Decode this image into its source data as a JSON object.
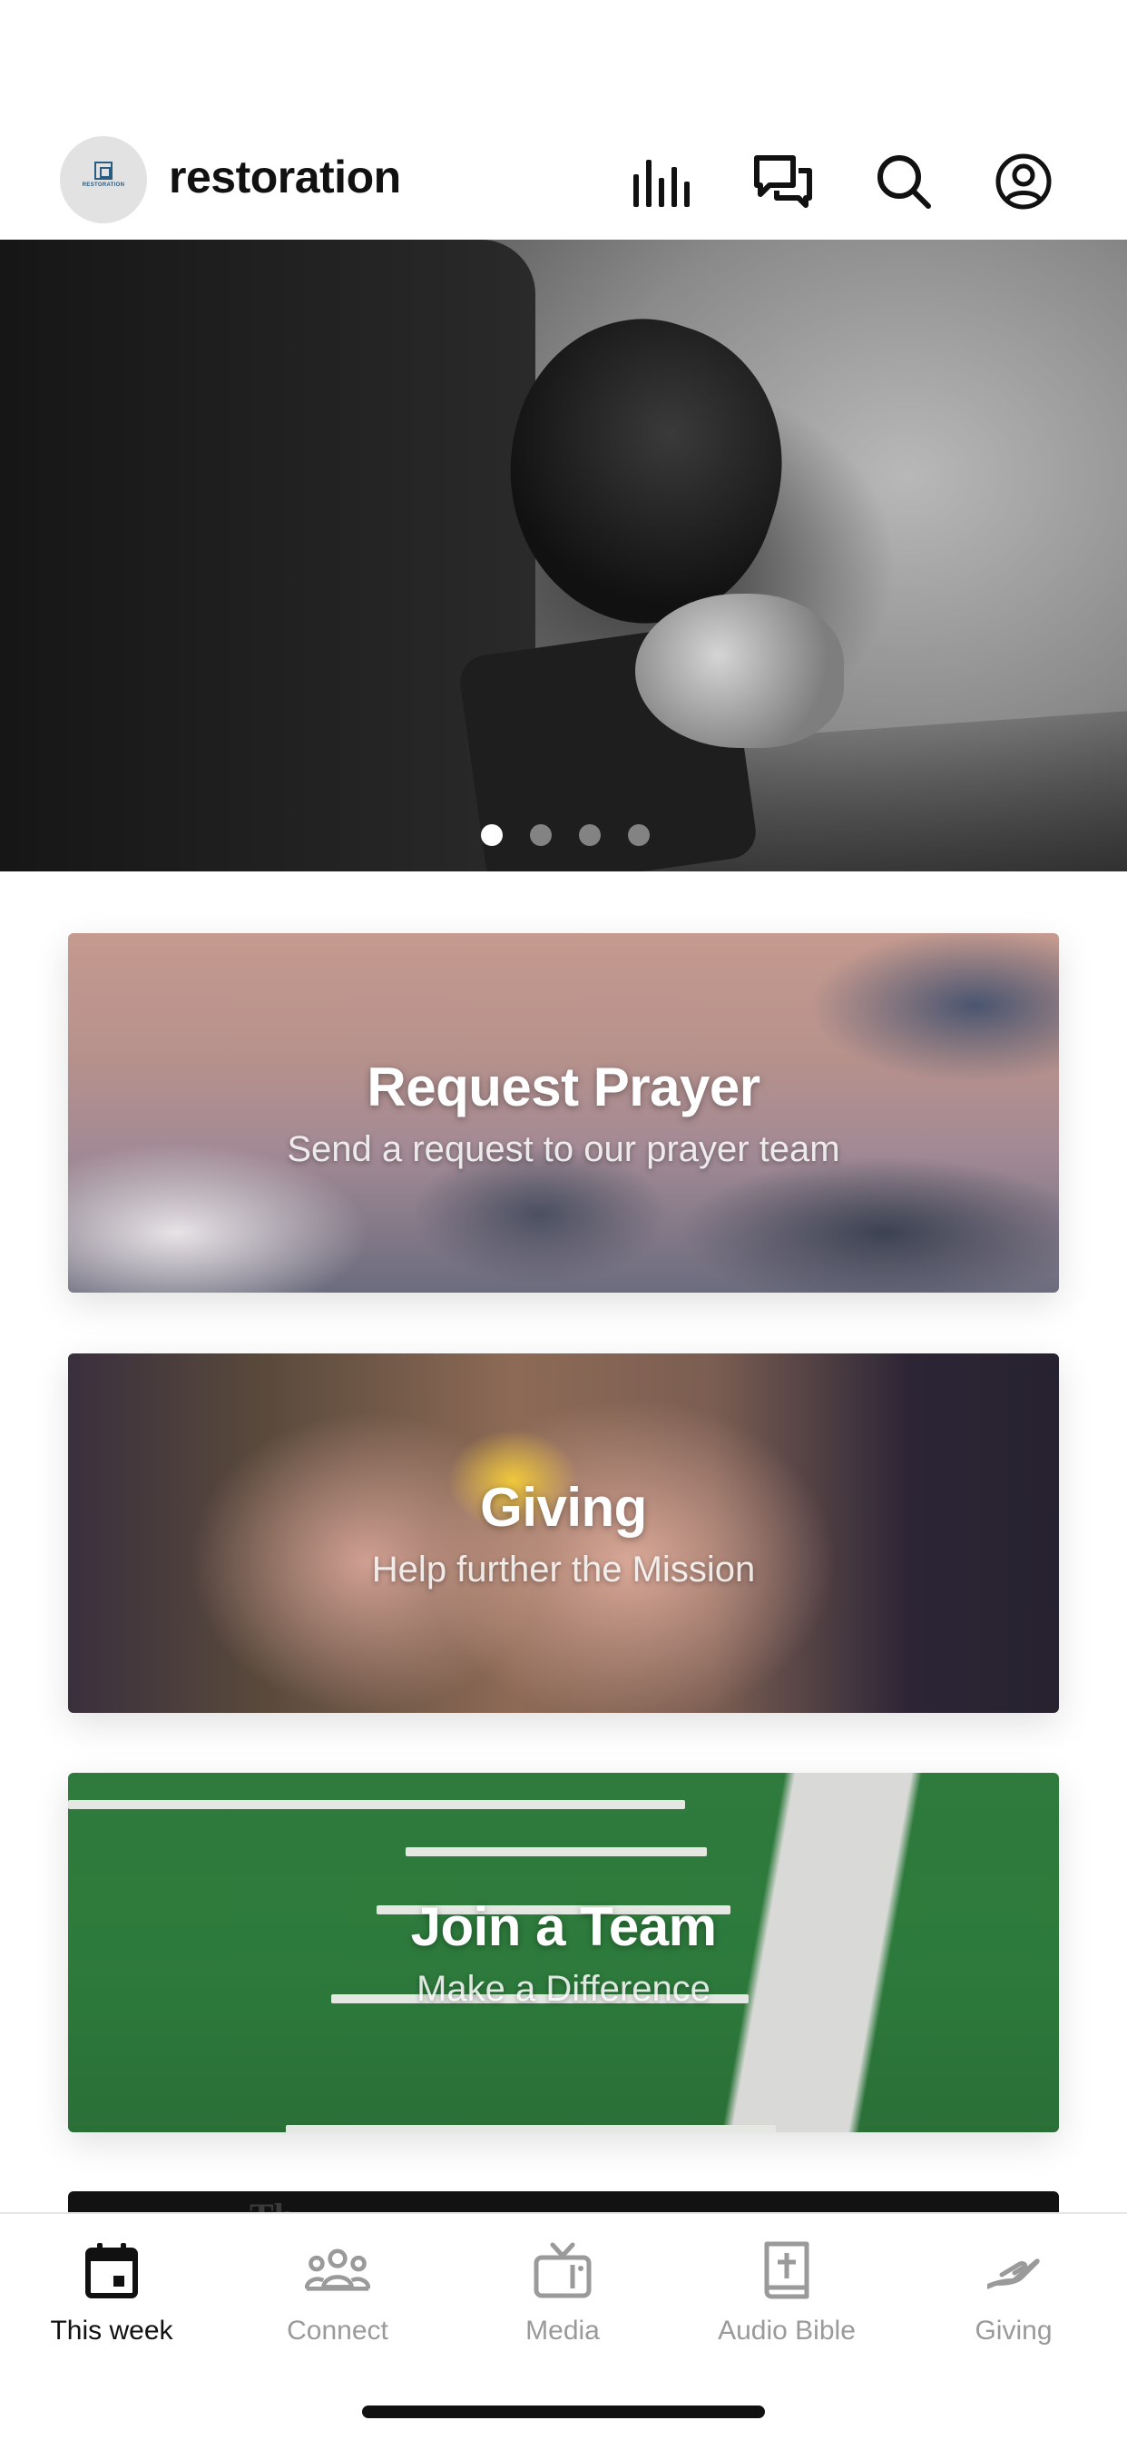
{
  "header": {
    "app_name": "restoration",
    "logo_text": "RESTORATION",
    "icons": [
      "equalizer-icon",
      "chat-bubbles-icon",
      "search-icon",
      "account-icon"
    ]
  },
  "hero": {
    "slides_total": 4,
    "active_slide": 1
  },
  "cards": [
    {
      "title": "Request Prayer",
      "subtitle": "Send a request to our prayer team"
    },
    {
      "title": "Giving",
      "subtitle": "Help further the Mission"
    },
    {
      "title": "Join a Team",
      "subtitle": "Make a Difference"
    }
  ],
  "tabbar": {
    "active": "This week",
    "tabs": [
      {
        "label": "This week",
        "icon": "calendar-icon"
      },
      {
        "label": "Connect",
        "icon": "group-icon"
      },
      {
        "label": "Media",
        "icon": "tv-icon"
      },
      {
        "label": "Audio Bible",
        "icon": "bible-icon"
      },
      {
        "label": "Giving",
        "icon": "giving-hand-icon"
      }
    ]
  },
  "colors": {
    "active_tab": "#111111",
    "inactive_tab": "#9a9a9a",
    "background": "#ffffff"
  }
}
